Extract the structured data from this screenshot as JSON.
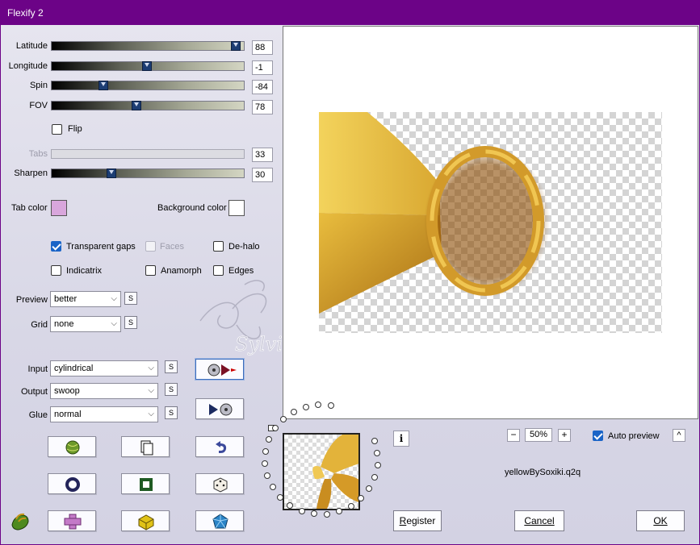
{
  "window": {
    "title": "Flexify 2"
  },
  "sliders": [
    {
      "label": "Latitude",
      "value": "88",
      "fraction": 0.96
    },
    {
      "label": "Longitude",
      "value": "-1",
      "fraction": 0.495
    },
    {
      "label": "Spin",
      "value": "-84",
      "fraction": 0.27
    },
    {
      "label": "FOV",
      "value": "78",
      "fraction": 0.44
    },
    {
      "label": "Tabs",
      "value": "33",
      "fraction": null,
      "disabled": true
    },
    {
      "label": "Sharpen",
      "value": "30",
      "fraction": 0.31
    }
  ],
  "flip": {
    "label": "Flip",
    "checked": false
  },
  "tab_color": {
    "label": "Tab color",
    "color": "#d9a6dc"
  },
  "background_color": {
    "label": "Background color",
    "color": "#ffffff"
  },
  "options": {
    "transparent_gaps": {
      "label": "Transparent gaps",
      "checked": true
    },
    "faces": {
      "label": "Faces",
      "checked": false,
      "disabled": true
    },
    "de_halo": {
      "label": "De-halo",
      "checked": false
    },
    "indicatrix": {
      "label": "Indicatrix",
      "checked": false
    },
    "anamorph": {
      "label": "Anamorph",
      "checked": false
    },
    "edges": {
      "label": "Edges",
      "checked": false
    }
  },
  "preview_quality": {
    "label": "Preview",
    "value": "better"
  },
  "grid": {
    "label": "Grid",
    "value": "none"
  },
  "input": {
    "label": "Input",
    "value": "cylindrical"
  },
  "output": {
    "label": "Output",
    "value": "swoop"
  },
  "glue": {
    "label": "Glue",
    "value": "normal"
  },
  "s_button_label": "S",
  "watermark": "Sylviane",
  "zoom": {
    "minus": "−",
    "value": "50%",
    "plus": "+"
  },
  "auto_preview": {
    "label": "Auto preview",
    "checked": true
  },
  "collapse_label": "^",
  "info_label": "i",
  "preset_name": "yellowBySoxiki.q2q",
  "buttons": {
    "register": "Register",
    "cancel": "Cancel",
    "ok": "OK"
  },
  "accent_colors": {
    "title_bar": "#6c0387",
    "checkbox": "#1a64c7",
    "slider_thumb": "#1c3d73"
  }
}
